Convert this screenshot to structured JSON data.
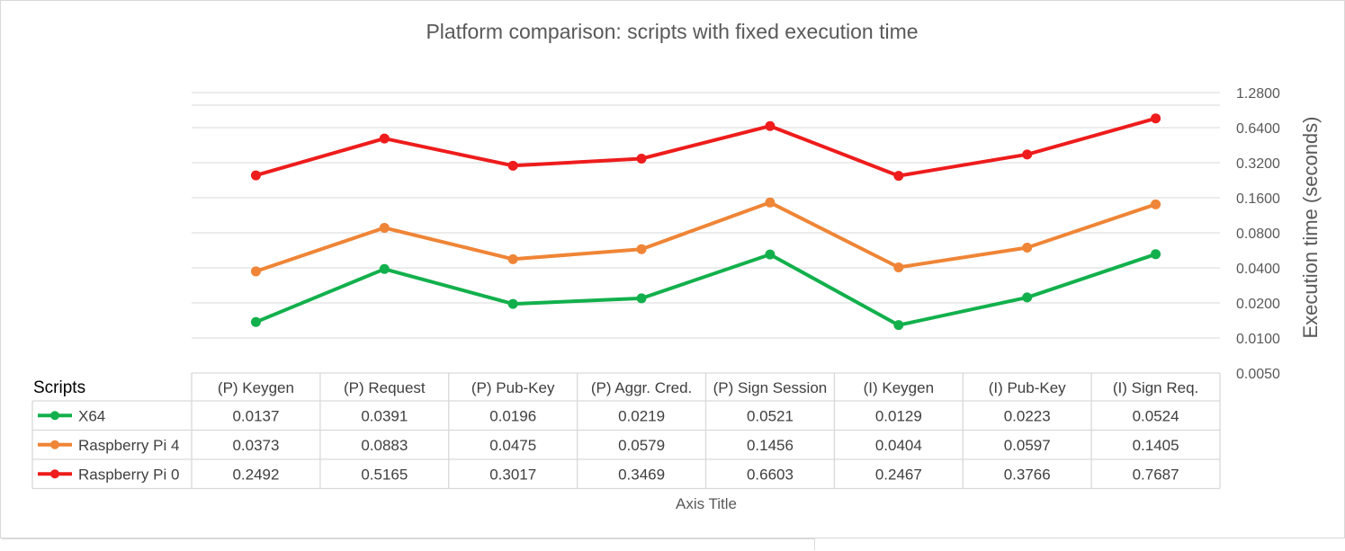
{
  "chart_data": {
    "type": "line",
    "title": "Platform comparison: scripts with fixed execution time",
    "xlabel": "Axis Title",
    "ylabel": "Execution time (seconds)",
    "y_scale": "log2",
    "ylim": [
      0.005,
      1.28
    ],
    "yticks": [
      "1.2800",
      "0.6400",
      "0.3200",
      "0.1600",
      "0.0800",
      "0.0400",
      "0.0200",
      "0.0100",
      "0.0050"
    ],
    "table_header": "Scripts",
    "categories": [
      "(P) Keygen",
      "(P) Request",
      "(P) Pub-Key",
      "(P) Aggr. Cred.",
      "(P) Sign Session",
      "(I) Keygen",
      "(I) Pub-Key",
      "(I) Sign Req."
    ],
    "series": [
      {
        "name": "X64",
        "color": "#12b04c",
        "values": [
          0.0137,
          0.0391,
          0.0196,
          0.0219,
          0.0521,
          0.0129,
          0.0223,
          0.0524
        ],
        "labels": [
          "0.0137",
          "0.0391",
          "0.0196",
          "0.0219",
          "0.0521",
          "0.0129",
          "0.0223",
          "0.0524"
        ]
      },
      {
        "name": "Raspberry Pi 4",
        "color": "#ef8536",
        "values": [
          0.0373,
          0.0883,
          0.0475,
          0.0579,
          0.1456,
          0.0404,
          0.0597,
          0.1405
        ],
        "labels": [
          "0.0373",
          "0.0883",
          "0.0475",
          "0.0579",
          "0.1456",
          "0.0404",
          "0.0597",
          "0.1405"
        ]
      },
      {
        "name": "Raspberry Pi 0",
        "color": "#ee1c1c",
        "values": [
          0.2492,
          0.5165,
          0.3017,
          0.3469,
          0.6603,
          0.2467,
          0.3766,
          0.7687
        ],
        "labels": [
          "0.2492",
          "0.5165",
          "0.3017",
          "0.3469",
          "0.6603",
          "0.2467",
          "0.3766",
          "0.7687"
        ]
      }
    ]
  }
}
